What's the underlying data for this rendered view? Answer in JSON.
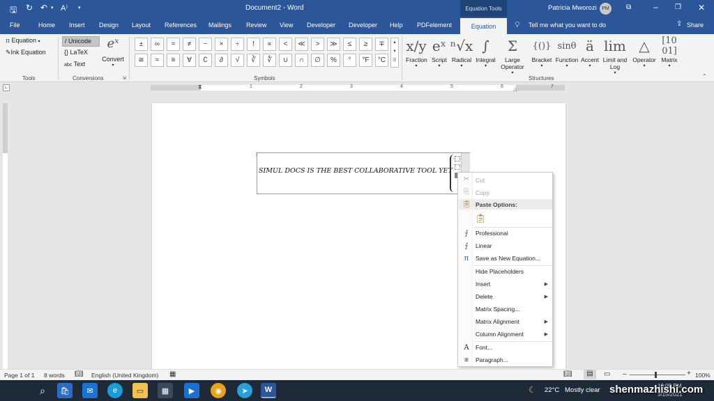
{
  "titlebar": {
    "doc_title": "Document2 - Word",
    "context_tab": "Equation Tools",
    "user": "Patricia Mworozi",
    "initials": "PM"
  },
  "tabs": [
    "File",
    "Home",
    "Insert",
    "Design",
    "Layout",
    "References",
    "Mailings",
    "Review",
    "View",
    "Developer",
    "Developer",
    "Help",
    "PDFelement",
    "Equation"
  ],
  "tell_me": "Tell me what you want to do",
  "share": "Share",
  "tools": {
    "equation": "Equation",
    "ink": "Ink Equation",
    "label": "Tools"
  },
  "conversions": {
    "unicode": "Unicode",
    "latex": "LaTeX",
    "text": "Text",
    "convert": "Convert",
    "label": "Conversions"
  },
  "symbols_label": "Symbols",
  "symbols_row1": [
    "±",
    "∞",
    "=",
    "≠",
    "~",
    "×",
    "÷",
    "!",
    "∝",
    "<",
    "≪",
    ">",
    "≫",
    "≤",
    "≥",
    "∓"
  ],
  "symbols_row2": [
    "≅",
    "≈",
    "≡",
    "∀",
    "∁",
    "∂",
    "√",
    "∛",
    "∜",
    "∪",
    "∩",
    "∅",
    "%",
    "°",
    "°F",
    "°C"
  ],
  "structures": [
    {
      "icon": "x/y",
      "label": "Fraction"
    },
    {
      "icon": "eˣ",
      "label": "Script"
    },
    {
      "icon": "ⁿ√x",
      "label": "Radical"
    },
    {
      "icon": "∫",
      "label": "Integral"
    },
    {
      "icon": "Σ",
      "label": "Large Operator"
    },
    {
      "icon": "{()}",
      "label": "Bracket"
    },
    {
      "icon": "sinθ",
      "label": "Function"
    },
    {
      "icon": "ä",
      "label": "Accent"
    },
    {
      "icon": "lim",
      "label": "Limit and Log"
    },
    {
      "icon": "△",
      "label": "Operator"
    },
    {
      "icon": "[10 01]",
      "label": "Matrix"
    }
  ],
  "structures_label": "Structures",
  "equation_text": "SIMUL DOCS IS THE BEST COLLABORATIVE TOOL YET",
  "menu": {
    "cut": "Cut",
    "copy": "Copy",
    "paste_options": "Paste Options:",
    "professional": "Professional",
    "linear": "Linear",
    "save_as": "Save as New Equation...",
    "hide_placeholders": "Hide Placeholders",
    "insert": "Insert",
    "delete": "Delete",
    "matrix_spacing": "Matrix Spacing...",
    "matrix_alignment": "Matrix Alignment",
    "column_alignment": "Column Alignment",
    "font": "Font...",
    "paragraph": "Paragraph..."
  },
  "status": {
    "page": "Page 1 of 1",
    "words": "8 words",
    "language": "English (United Kingdom)",
    "zoom": "100%"
  },
  "taskbar": {
    "temp": "22°C",
    "weather": "Mostly clear",
    "time": "10:09 PM",
    "date": "3/15/2021",
    "watermark": "shenmazhishi.com"
  },
  "colors": {
    "accent": "#2b579a",
    "taskbar": "#1f2a38"
  }
}
